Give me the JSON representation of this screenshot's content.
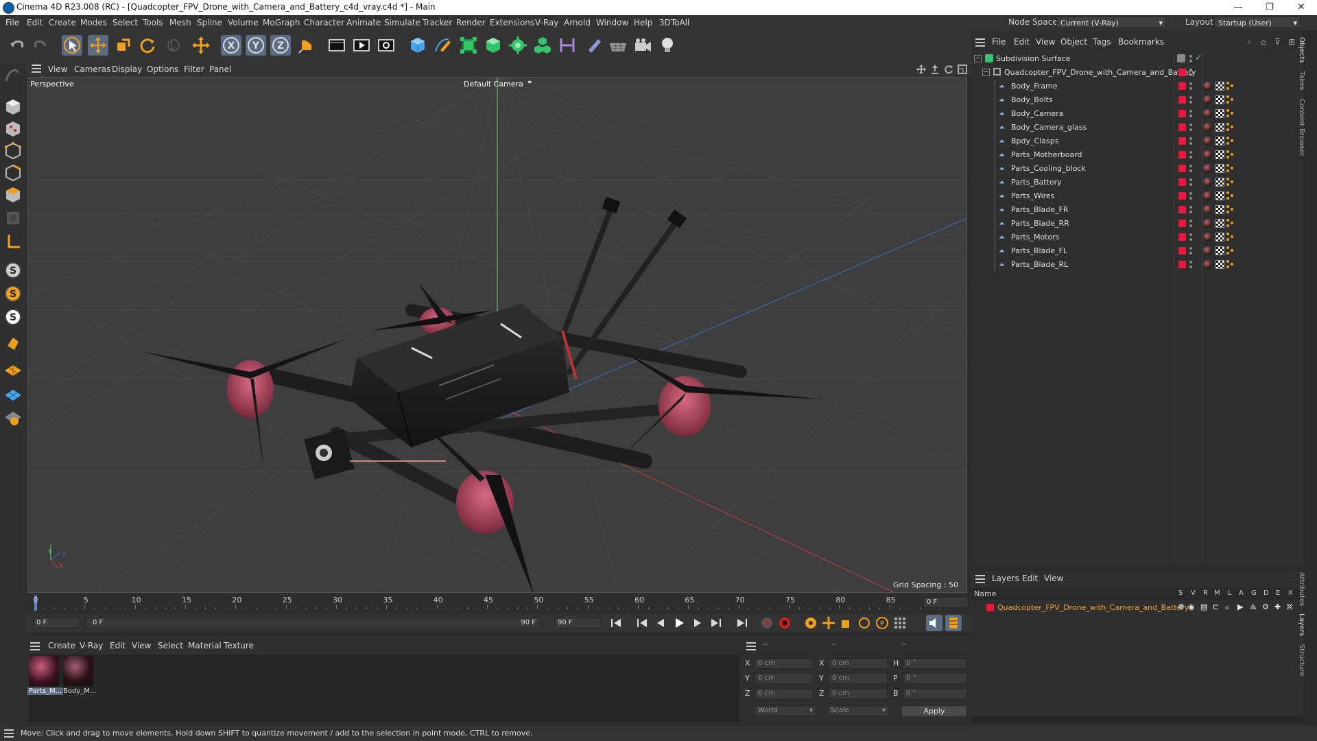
{
  "window": {
    "title": "Cinema 4D R23.008 (RC) - [Quadcopter_FPV_Drone_with_Camera_and_Battery_c4d_vray.c4d *] - Main",
    "minimize": "—",
    "maximize": "❐",
    "close": "✕"
  },
  "menubar": {
    "items": [
      "File",
      "Edit",
      "Create",
      "Modes",
      "Select",
      "Tools",
      "Mesh",
      "Spline",
      "Volume",
      "MoGraph",
      "Character",
      "Animate",
      "Simulate",
      "Tracker",
      "Render",
      "Extensions",
      "V-Ray",
      "Arnold",
      "Window",
      "Help",
      "3DToAll"
    ],
    "node_space_label": "Node Space:",
    "node_space_value": "Current (V-Ray)",
    "layout_label": "Layout:",
    "layout_value": "Startup (User)"
  },
  "viewport": {
    "menu": [
      "View",
      "Cameras",
      "Display",
      "Options",
      "Filter",
      "Panel"
    ],
    "label": "Perspective",
    "camera": "Default Camera",
    "grid_spacing": "Grid Spacing : 50 cm",
    "axis_y": "Y",
    "axis_z": "Z",
    "axis_x": "X"
  },
  "objects": {
    "menu": [
      "File",
      "Edit",
      "View",
      "Object",
      "Tags",
      "Bookmarks"
    ],
    "root": "Subdivision Surface",
    "group": "Quadcopter_FPV_Drone_with_Camera_and_Battery",
    "children": [
      "Body_Frame",
      "Body_Bolts",
      "Body_Camera",
      "Body_Camera_glass",
      "Bpdy_Clasps",
      "Parts_Motherboard",
      "Parts_Cooling_block",
      "Parts_Battery",
      "Parts_Wires",
      "Parts_Blade_FR",
      "Parts_Blade_RR",
      "Parts_Motors",
      "Parts_Blade_FL",
      "Parts_Blade_RL"
    ]
  },
  "layers": {
    "menu": [
      "Layers",
      "Edit",
      "View"
    ],
    "name_header": "Name",
    "flags": [
      "S",
      "V",
      "R",
      "M",
      "L",
      "A",
      "G",
      "D",
      "E",
      "X"
    ],
    "row": "Quadcopter_FPV_Drone_with_Camera_and_Battery"
  },
  "right_tabs": [
    "Objects",
    "Takes",
    "Content Browser",
    "Attributes",
    "Layers",
    "Structure"
  ],
  "timeline": {
    "ticks": [
      "0",
      "5",
      "10",
      "15",
      "20",
      "25",
      "30",
      "35",
      "40",
      "45",
      "50",
      "55",
      "60",
      "65",
      "70",
      "75",
      "80",
      "85",
      "90"
    ],
    "current_frame": "0 F",
    "start": "0 F",
    "range_start": "0 F",
    "range_end": "90 F",
    "end": "90 F"
  },
  "materials": {
    "menu": [
      "Create",
      "V-Ray",
      "Edit",
      "View",
      "Select",
      "Material",
      "Texture"
    ],
    "items": [
      "Parts_M...",
      "Body_M..."
    ]
  },
  "coords": {
    "head1": "--",
    "head2": "--",
    "head3": "--",
    "rows": [
      {
        "a": "X",
        "av": "0 cm",
        "b": "X",
        "bv": "0 cm",
        "c": "H",
        "cv": "0 °"
      },
      {
        "a": "Y",
        "av": "0 cm",
        "b": "Y",
        "bv": "0 cm",
        "c": "P",
        "cv": "0 °"
      },
      {
        "a": "Z",
        "av": "0 cm",
        "b": "Z",
        "bv": "0 cm",
        "c": "B",
        "cv": "0 °"
      }
    ],
    "world": "World",
    "scale": "Scale",
    "apply": "Apply"
  },
  "status": "Move: Click and drag to move elements. Hold down SHIFT to quantize movement / add to the selection in point mode, CTRL to remove.",
  "colors": {
    "accent": "#5a6b82",
    "tag_red": "#e8193c",
    "layer_text": "#f2a33a"
  }
}
